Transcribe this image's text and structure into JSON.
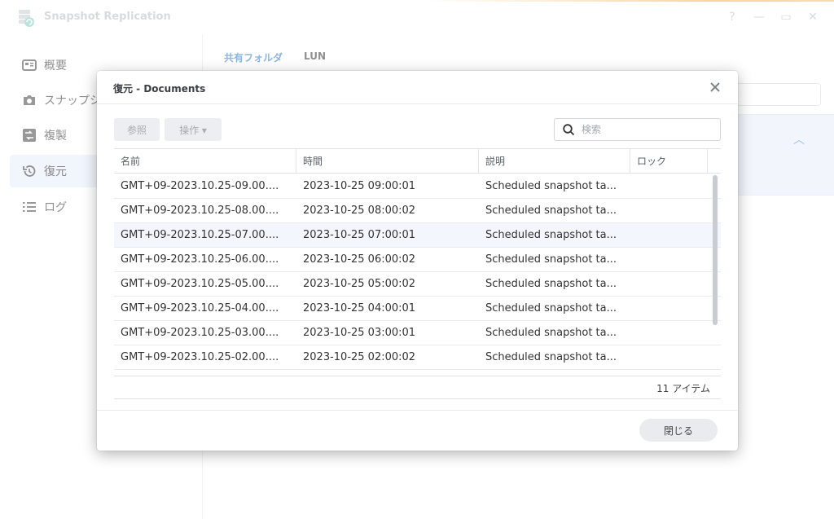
{
  "app": {
    "title": "Snapshot Replication",
    "controls": {
      "help": "?",
      "minimize": "—",
      "maximize": "▭",
      "close": "✕"
    }
  },
  "sidebar": {
    "items": [
      {
        "label": "概要",
        "icon": "overview-icon"
      },
      {
        "label": "スナップシ",
        "icon": "camera-icon"
      },
      {
        "label": "複製",
        "icon": "replication-icon"
      },
      {
        "label": "復元",
        "icon": "restore-icon",
        "active": true
      },
      {
        "label": "ログ",
        "icon": "list-icon"
      }
    ]
  },
  "main": {
    "tabs": [
      {
        "label": "共有フォルダ",
        "active": true
      },
      {
        "label": "LUN"
      }
    ]
  },
  "dialog": {
    "title": "復元 - Documents",
    "toolbar": {
      "browse_label": "参照",
      "action_label": "操作 ▾"
    },
    "search_placeholder": "検索",
    "columns": [
      "名前",
      "時間",
      "説明",
      "ロック"
    ],
    "rows": [
      {
        "name": "GMT+09-2023.10.25-09.00....",
        "time": "2023-10-25 09:00:01",
        "description": "Scheduled snapshot ta...",
        "lock": ""
      },
      {
        "name": "GMT+09-2023.10.25-08.00....",
        "time": "2023-10-25 08:00:02",
        "description": "Scheduled snapshot ta...",
        "lock": ""
      },
      {
        "name": "GMT+09-2023.10.25-07.00....",
        "time": "2023-10-25 07:00:01",
        "description": "Scheduled snapshot ta...",
        "lock": ""
      },
      {
        "name": "GMT+09-2023.10.25-06.00....",
        "time": "2023-10-25 06:00:02",
        "description": "Scheduled snapshot ta...",
        "lock": ""
      },
      {
        "name": "GMT+09-2023.10.25-05.00....",
        "time": "2023-10-25 05:00:02",
        "description": "Scheduled snapshot ta...",
        "lock": ""
      },
      {
        "name": "GMT+09-2023.10.25-04.00....",
        "time": "2023-10-25 04:00:01",
        "description": "Scheduled snapshot ta...",
        "lock": ""
      },
      {
        "name": "GMT+09-2023.10.25-03.00....",
        "time": "2023-10-25 03:00:01",
        "description": "Scheduled snapshot ta...",
        "lock": ""
      },
      {
        "name": "GMT+09-2023.10.25-02.00....",
        "time": "2023-10-25 02:00:02",
        "description": "Scheduled snapshot ta...",
        "lock": ""
      }
    ],
    "item_count": "11 アイテム",
    "close_label": "閉じる"
  },
  "colors": {
    "accent": "#2f7ad0",
    "selected": "#e5edf9"
  }
}
